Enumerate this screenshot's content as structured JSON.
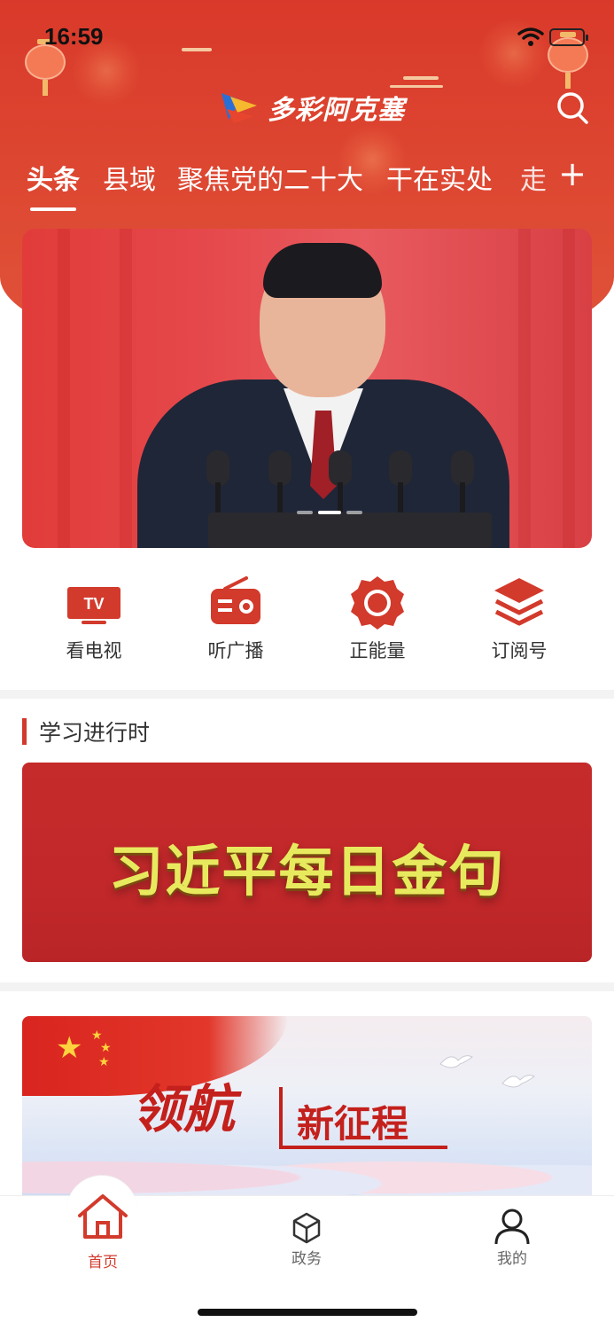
{
  "status_bar": {
    "time": "16:59"
  },
  "header": {
    "app_name": "多彩阿克塞",
    "tabs": [
      {
        "label": "头条",
        "active": true
      },
      {
        "label": "县域",
        "active": false
      },
      {
        "label": "聚焦党的二十大",
        "active": false
      },
      {
        "label": "干在实处",
        "active": false
      },
      {
        "label": "走",
        "active": false
      }
    ],
    "add_tab_label": "+"
  },
  "banner": {
    "slide_index": 2,
    "slide_count": 3
  },
  "quick_menu": [
    {
      "label": "看电视",
      "icon": "tv-icon"
    },
    {
      "label": "听广播",
      "icon": "radio-icon"
    },
    {
      "label": "正能量",
      "icon": "energy-icon"
    },
    {
      "label": "订阅号",
      "icon": "subscribe-icon"
    }
  ],
  "section": {
    "title": "学习进行时"
  },
  "study_card": {
    "headline": "习近平每日金句"
  },
  "promo_card": {
    "lead": "领航",
    "sub": "新征程"
  },
  "bottom_nav": [
    {
      "label": "首页",
      "icon": "home-icon",
      "active": true
    },
    {
      "label": "政务",
      "icon": "government-icon",
      "active": false
    },
    {
      "label": "我的",
      "icon": "profile-icon",
      "active": false
    }
  ],
  "colors": {
    "accent": "#d23a2c",
    "header": "#d9392a",
    "study_bg": "#c52b2a",
    "study_text": "#e8ea5e"
  }
}
